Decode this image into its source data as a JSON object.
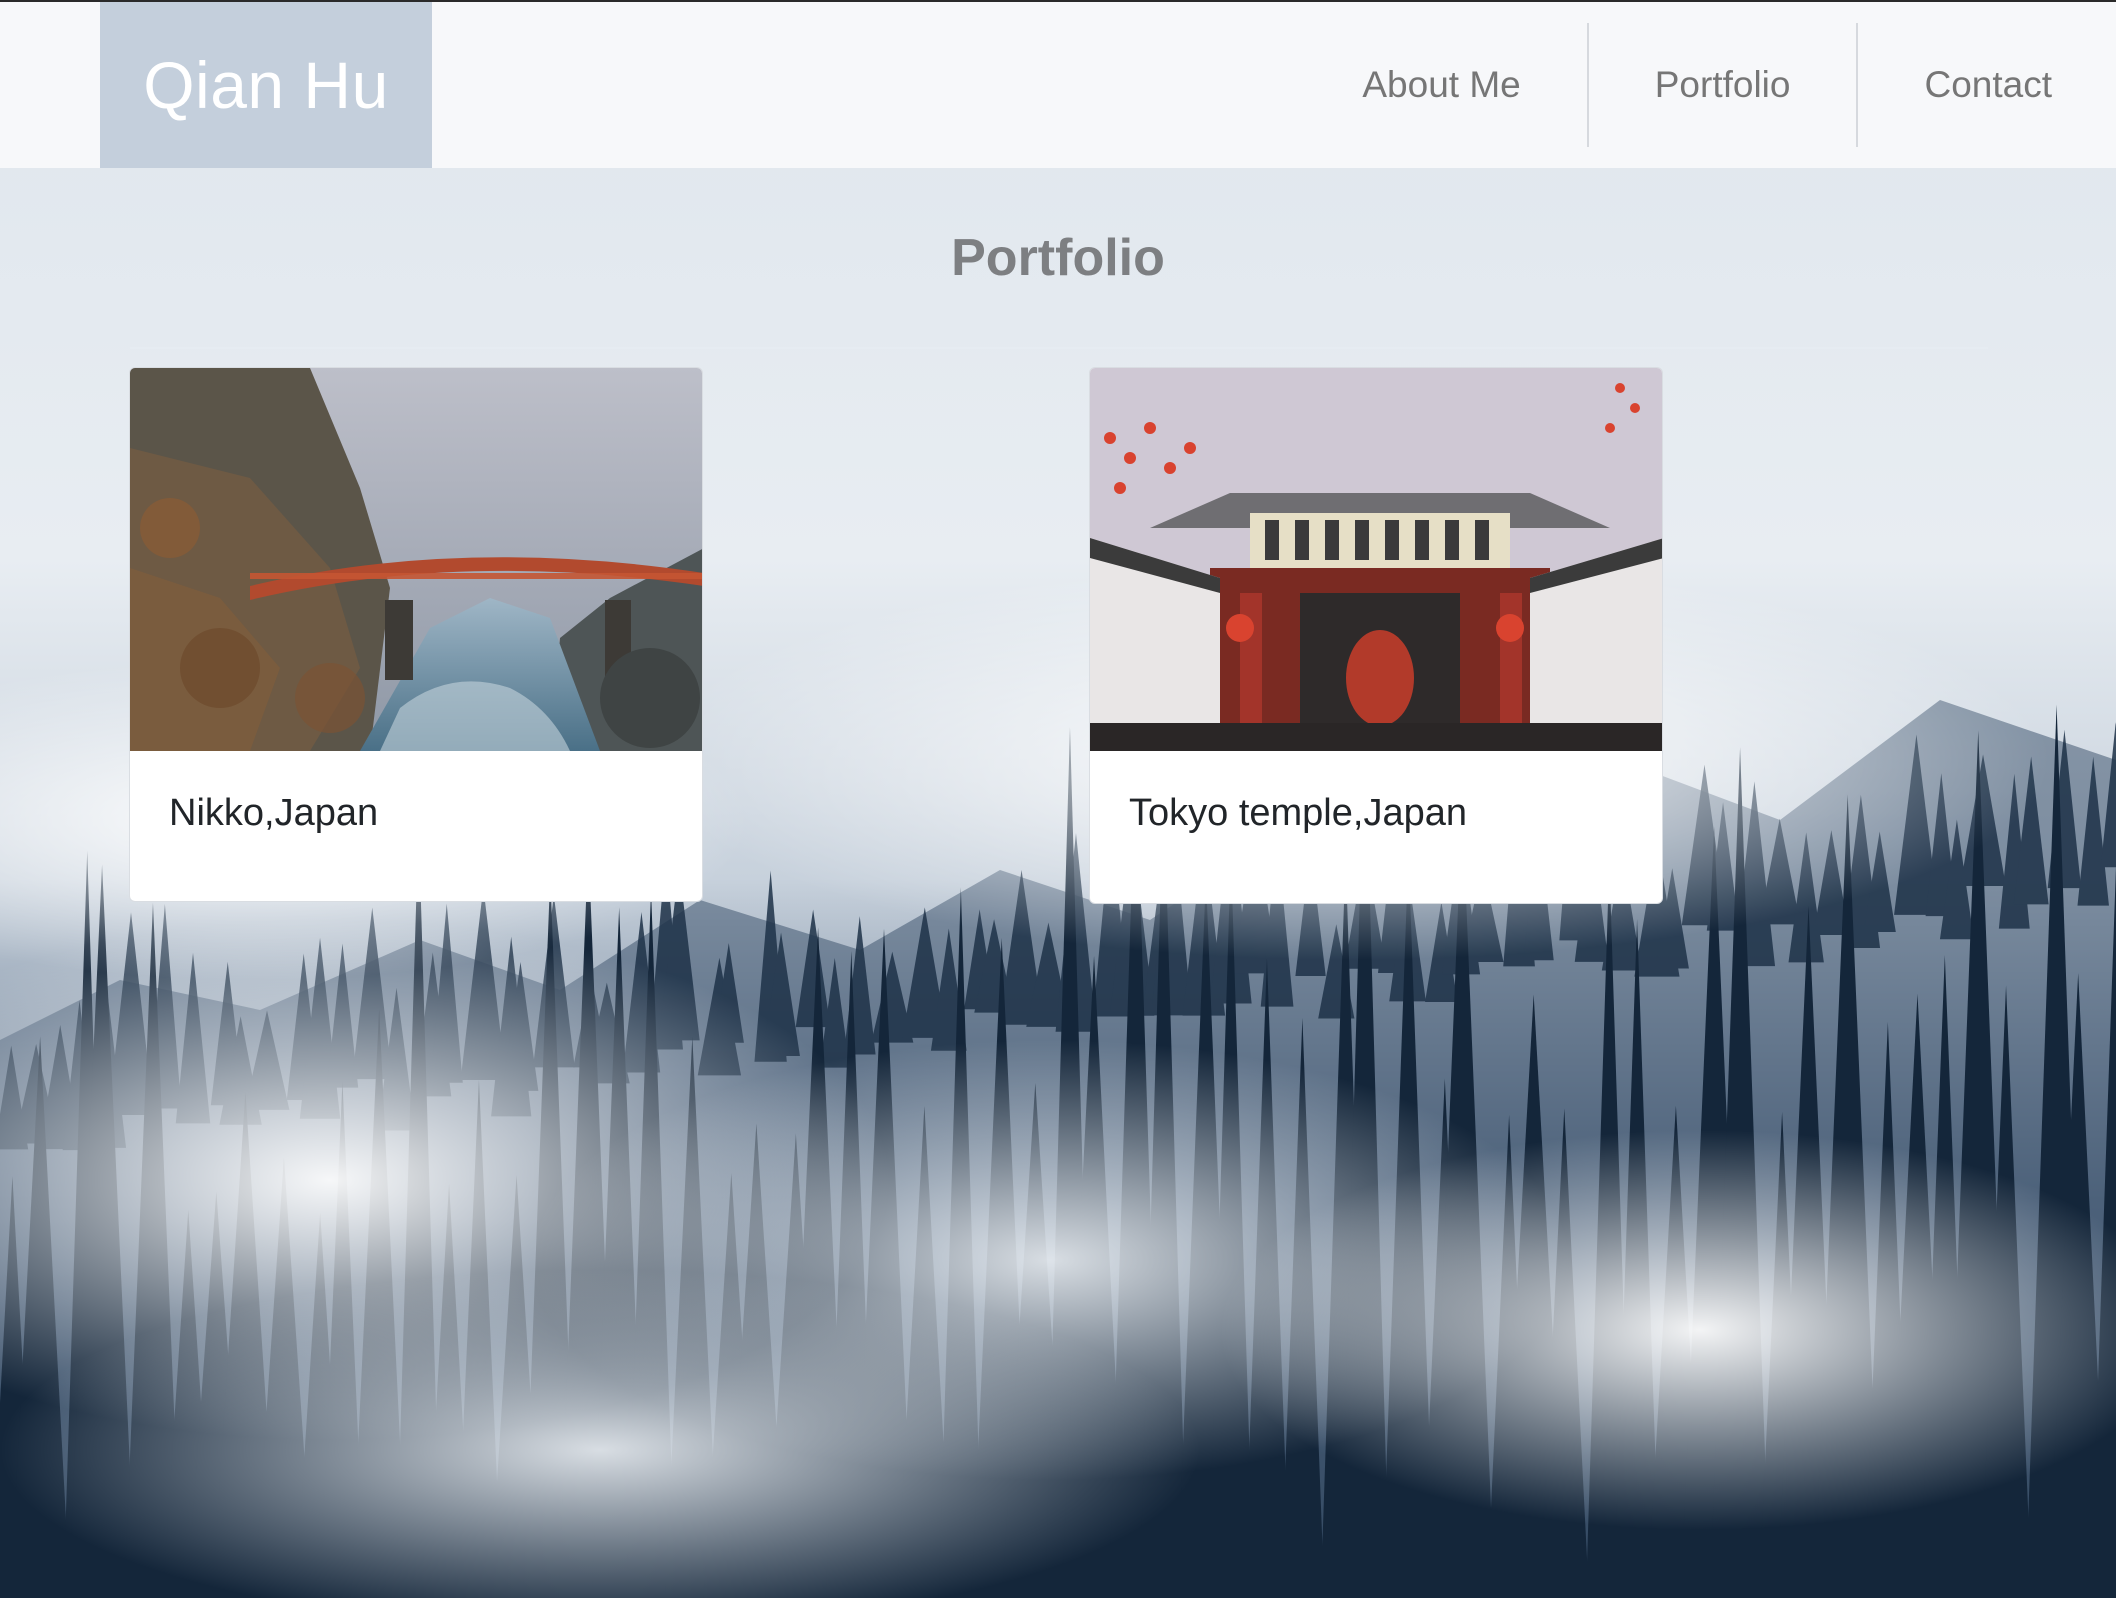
{
  "navbar": {
    "brand": "Qian Hu",
    "links": [
      "About Me",
      "Portfolio",
      "Contact"
    ]
  },
  "main": {
    "title": "Portfolio",
    "cards": [
      {
        "title": "Nikko,Japan"
      },
      {
        "title": "Tokyo temple,Japan"
      }
    ]
  },
  "colors": {
    "navbar_bg": "#f7f8fa",
    "brand_bg": "#c4cfdc",
    "nav_text": "#767676",
    "title_text": "#7d7f82",
    "card_text": "#212529"
  }
}
